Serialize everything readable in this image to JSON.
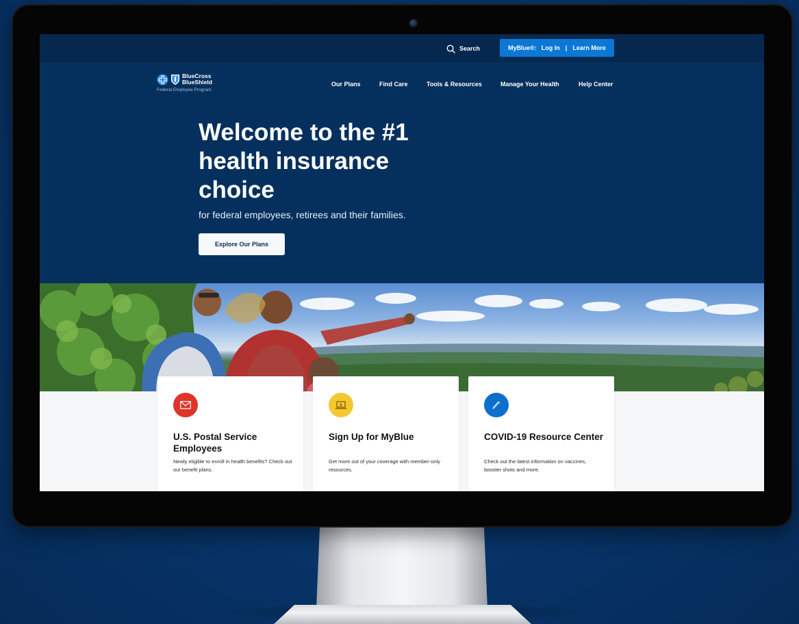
{
  "topbar": {
    "search_label": "Search",
    "myblue_label": "MyBlue®:",
    "login_label": "Log In",
    "separator": "|",
    "learn_more_label": "Learn More"
  },
  "logo": {
    "line1": "BlueCross",
    "line2": "BlueShield",
    "tagline": "Federal Employee Program."
  },
  "nav": {
    "items": [
      {
        "label": "Our Plans"
      },
      {
        "label": "Find Care"
      },
      {
        "label": "Tools & Resources"
      },
      {
        "label": "Manage Your Health"
      },
      {
        "label": "Help Center"
      }
    ]
  },
  "hero": {
    "title": "Welcome to the #1 health insurance choice",
    "subtitle": "for federal employees, retirees and their families.",
    "cta_label": "Explore Our Plans"
  },
  "cards": [
    {
      "icon": "envelope-icon",
      "icon_color": "#e0342b",
      "title": "U.S. Postal Service Employees",
      "description": "Newly eligible to enroll in health benefits? Check out our benefit plans."
    },
    {
      "icon": "laptop-icon",
      "icon_color": "#f5c730",
      "title": "Sign Up for MyBlue",
      "description": "Get more out of your coverage with member-only resources."
    },
    {
      "icon": "syringe-icon",
      "icon_color": "#0b6fd0",
      "title": "COVID-19 Resource Center",
      "description": "Check out the latest information on vaccines, booster shots and more."
    }
  ],
  "colors": {
    "page_background": "#073367",
    "header": "#07284e",
    "hero": "#05305e",
    "accent_button": "#0b78d6"
  }
}
